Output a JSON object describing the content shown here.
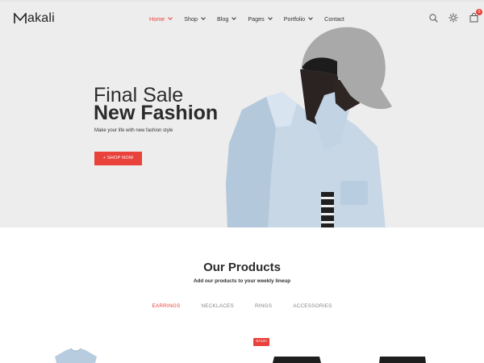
{
  "brand": {
    "logo_text": "akali",
    "logo_mark": "M"
  },
  "nav": {
    "items": [
      {
        "label": "Home",
        "active": true,
        "dropdown": true
      },
      {
        "label": "Shop",
        "active": false,
        "dropdown": true
      },
      {
        "label": "Blog",
        "active": false,
        "dropdown": true
      },
      {
        "label": "Pages",
        "active": false,
        "dropdown": true
      },
      {
        "label": "Portfolio",
        "active": false,
        "dropdown": true
      },
      {
        "label": "Contact",
        "active": false,
        "dropdown": false
      }
    ]
  },
  "header_icons": {
    "search": "search-icon",
    "settings": "gear-icon",
    "cart": "bag-icon",
    "cart_count": "0"
  },
  "hero": {
    "line1": "Final Sale",
    "line2": "New Fashion",
    "subtitle": "Make your life with new fashion style",
    "cta_label": "+ SHOP NOW"
  },
  "products": {
    "title": "Our Products",
    "subtitle": "Add our products to your weekly lineup",
    "tabs": [
      {
        "label": "EARRINGS",
        "active": true
      },
      {
        "label": "NECKLACES",
        "active": false
      },
      {
        "label": "RINGS",
        "active": false
      },
      {
        "label": "ACCESSORIES",
        "active": false
      }
    ],
    "sale_badge": "SALE!"
  },
  "colors": {
    "accent": "#e8423b",
    "hero_bg": "#ededed",
    "text": "#2b2b2b"
  }
}
